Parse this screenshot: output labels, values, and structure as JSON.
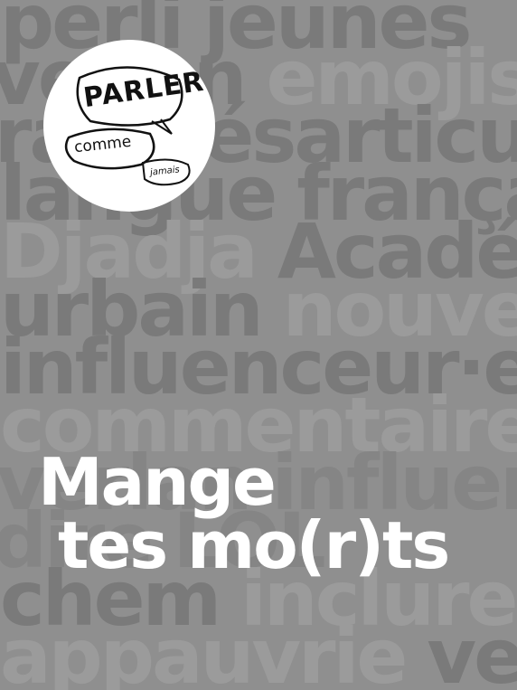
{
  "background_words": [
    {
      "words": [
        {
          "text": "perli",
          "tone": "dark"
        },
        {
          "text": "jeunes",
          "tone": "dark"
        }
      ]
    },
    {
      "words": [
        {
          "text": "verlan",
          "tone": "dark"
        },
        {
          "text": "emojis",
          "tone": "light"
        }
      ]
    },
    {
      "words": [
        {
          "text": "rap",
          "tone": "dark"
        },
        {
          "text": "désarticulé",
          "tone": "dark"
        }
      ]
    },
    {
      "words": [
        {
          "text": "langue",
          "tone": "dark"
        },
        {
          "text": "française",
          "tone": "dark"
        }
      ]
    },
    {
      "words": [
        {
          "text": "Djadja",
          "tone": "light"
        },
        {
          "text": "Académie",
          "tone": "dark"
        }
      ]
    },
    {
      "words": [
        {
          "text": "urbain",
          "tone": "dark"
        },
        {
          "text": "nouveau",
          "tone": "light"
        }
      ]
    },
    {
      "words": [
        {
          "text": "influenceur·euse",
          "tone": "dark"
        }
      ]
    },
    {
      "words": [
        {
          "text": "commentaires",
          "tone": "light"
        }
      ]
    },
    {
      "words": [
        {
          "text": "verlan",
          "tone": "mid"
        },
        {
          "text": "influenceur",
          "tone": "mid"
        }
      ]
    },
    {
      "words": [
        {
          "text": "dire",
          "tone": "mid"
        },
        {
          "text": "LOL",
          "tone": "mid"
        }
      ]
    },
    {
      "words": [
        {
          "text": "chem",
          "tone": "dark"
        },
        {
          "text": "inclure",
          "tone": "light"
        }
      ]
    },
    {
      "words": [
        {
          "text": "appauvrie",
          "tone": "light"
        },
        {
          "text": "verlan",
          "tone": "dark"
        }
      ]
    }
  ],
  "logo": {
    "line1": "PARLER",
    "line2": "comme",
    "line3": "jamais"
  },
  "title": {
    "line1": "Mange",
    "line2": "tes mo(r)ts"
  },
  "colors": {
    "background": "#8f8f8f",
    "title": "#ffffff",
    "logo_bg": "#ffffff"
  }
}
